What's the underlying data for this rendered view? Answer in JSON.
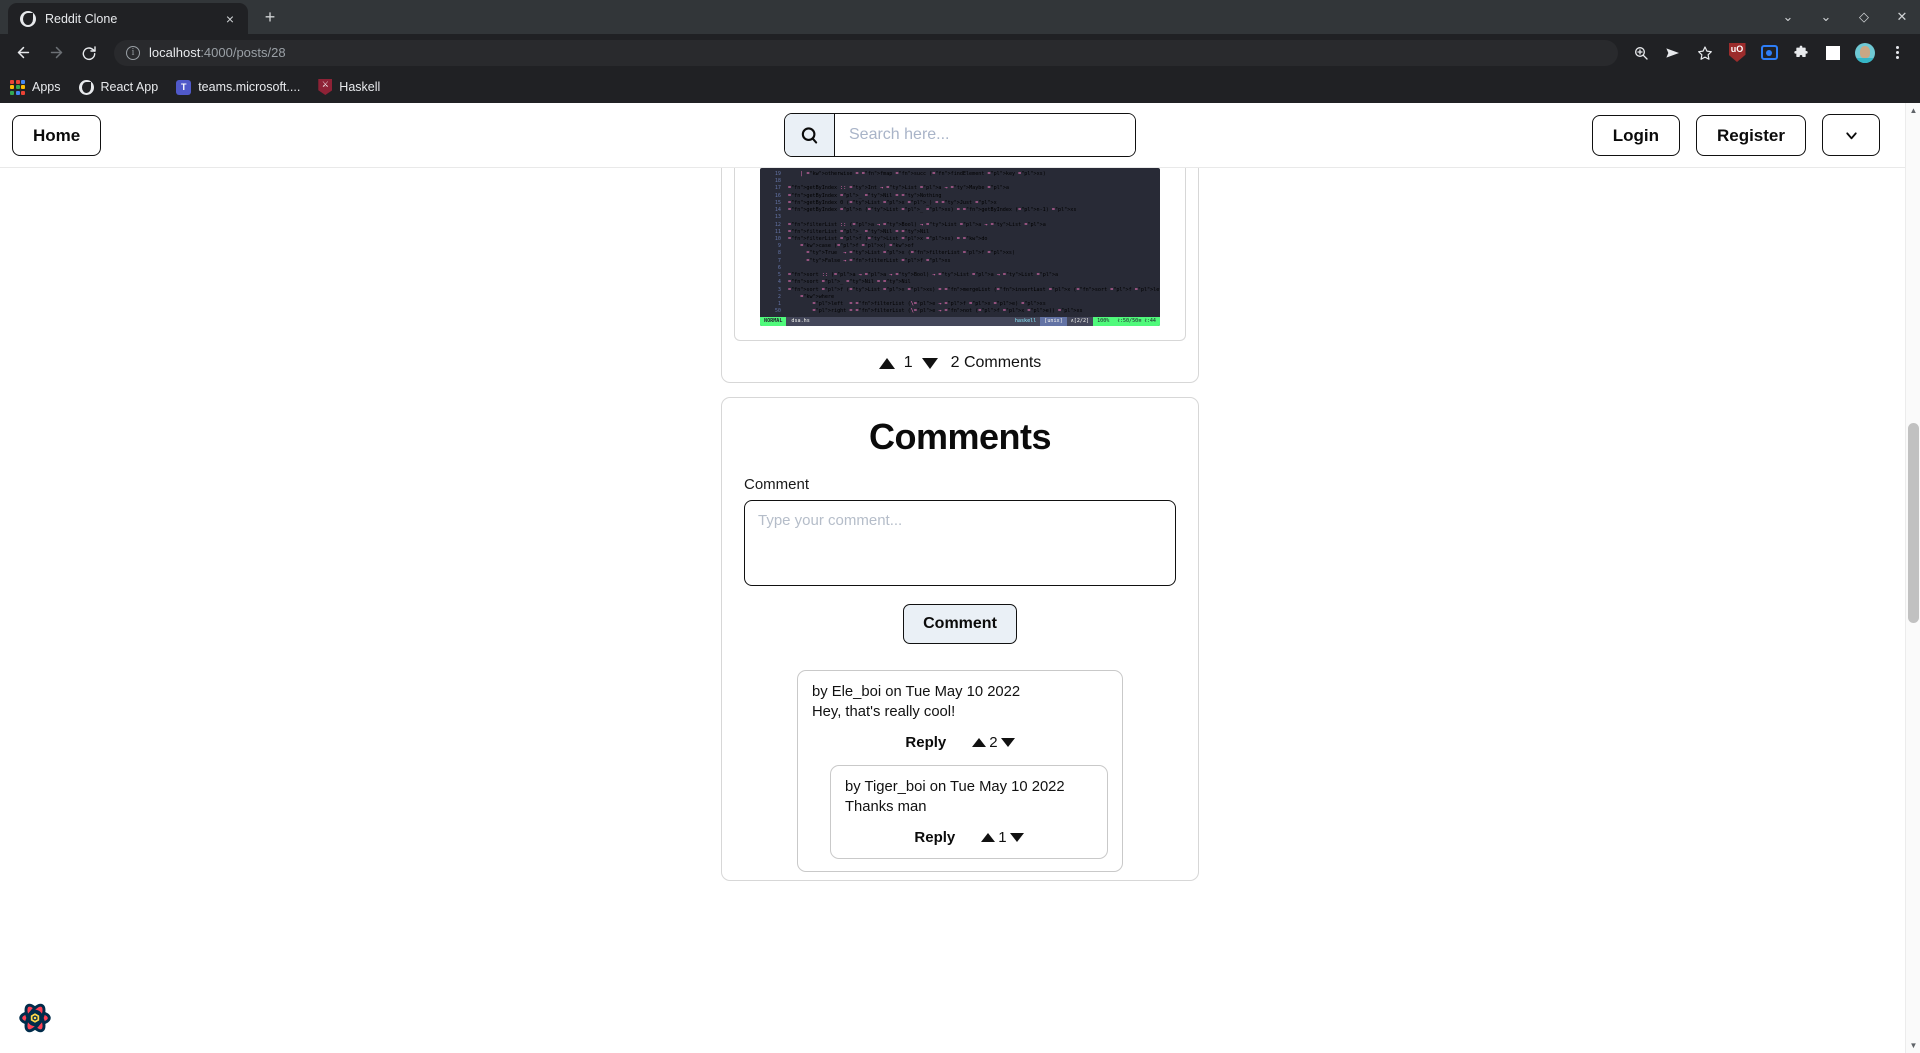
{
  "browser": {
    "tab": {
      "title": "Reddit Clone",
      "favicon": "globe-icon",
      "close_label": "×"
    },
    "newtab_label": "+",
    "window_controls": [
      "⌄",
      "⌄",
      "◇",
      "✕"
    ],
    "url": {
      "host": "localhost",
      "path": ":4000/posts/28",
      "full": "localhost:4000/posts/28"
    },
    "bookmarks": [
      {
        "label": "Apps",
        "icon": "apps-grid-icon"
      },
      {
        "label": "React App",
        "icon": "react-app-icon"
      },
      {
        "label": "teams.microsoft....",
        "icon": "teams-icon"
      },
      {
        "label": "Haskell",
        "icon": "haskell-shield-icon"
      }
    ],
    "toolbar_icons": [
      "zoom-search-icon",
      "send-icon",
      "star-icon",
      "ublock-shield-icon",
      "blue-square-icon",
      "extensions-puzzle-icon",
      "white-square-icon",
      "profile-avatar-icon",
      "kebab-menu-icon"
    ],
    "ublock_label": "uO"
  },
  "header": {
    "home_label": "Home",
    "search_placeholder": "Search here...",
    "search_value": "",
    "login_label": "Login",
    "register_label": "Register",
    "dropdown_icon": "chevron-down-icon"
  },
  "post": {
    "image_alt": "haskell-code-screenshot",
    "upvotes": "1",
    "comments_label": "2 Comments",
    "code": {
      "lines": [
        {
          "ln": "19",
          "text": "    | otherwise = fmap succ (findElement key xs)"
        },
        {
          "ln": "18",
          "text": ""
        },
        {
          "ln": "17",
          "text": "getByIndex :: Int → List a → Maybe a"
        },
        {
          "ln": "16",
          "text": "getByIndex _ Nil = Nothing"
        },
        {
          "ln": "15",
          "text": "getByIndex 0 (List x _) = Just x"
        },
        {
          "ln": "14",
          "text": "getByIndex n (List _ xs) = getByIndex (n-1) xs"
        },
        {
          "ln": "13",
          "text": ""
        },
        {
          "ln": "12",
          "text": "filterList :: (a → Bool) → List a → List a"
        },
        {
          "ln": "11",
          "text": "filterList _ Nil = Nil"
        },
        {
          "ln": "10",
          "text": "filterList f (List x xs) = do"
        },
        {
          "ln": "9",
          "text": "    case (f x) of"
        },
        {
          "ln": "8",
          "text": "      True  → List x (filterList f xs)"
        },
        {
          "ln": "7",
          "text": "      False → filterList f xs"
        },
        {
          "ln": "6",
          "text": ""
        },
        {
          "ln": "5",
          "text": "sort :: (a → a → Bool) → List a → List a"
        },
        {
          "ln": "4",
          "text": "sort _ Nil = Nil"
        },
        {
          "ln": "3",
          "text": "sort f (List x xs) = mergeList (insertLast x (sort f left)) (sort f right)"
        },
        {
          "ln": "2",
          "text": "    where"
        },
        {
          "ln": "1",
          "text": "        left  = filterList (\\e → f x e) xs"
        },
        {
          "ln": "50",
          "text": "        right = filterList (\\e → not (f x e)) xs"
        }
      ],
      "status": {
        "mode": "NORMAL",
        "file": "dsa.hs",
        "lang": "haskell",
        "encoding": "[unix]",
        "branch": "∧[2/2]",
        "percent": "100%",
        "position": "ℓ:50/50≡ ℓ:44"
      }
    }
  },
  "comments_section": {
    "title": "Comments",
    "form": {
      "label": "Comment",
      "placeholder": "Type your comment...",
      "value": "",
      "submit_label": "Comment"
    },
    "items": [
      {
        "byline": "by Ele_boi on Tue May 10 2022",
        "body": "Hey, that's really cool!",
        "reply_label": "Reply",
        "votes": "2",
        "nested": false
      },
      {
        "byline": "by Tiger_boi on Tue May 10 2022",
        "body": "Thanks man",
        "reply_label": "Reply",
        "votes": "1",
        "nested": true
      }
    ]
  },
  "devtools": {
    "icon": "react-query-flower-icon"
  },
  "colors": {
    "accent": "#eaf0f6",
    "border": "#111111",
    "chrome_bg": "#202124",
    "tabstrip_bg": "#323639",
    "code_bg": "#282a36",
    "vim_green": "#50fa7b",
    "flower_red": "#ff4154",
    "flower_navy": "#002c4b",
    "flower_yellow": "#ffd94c"
  }
}
